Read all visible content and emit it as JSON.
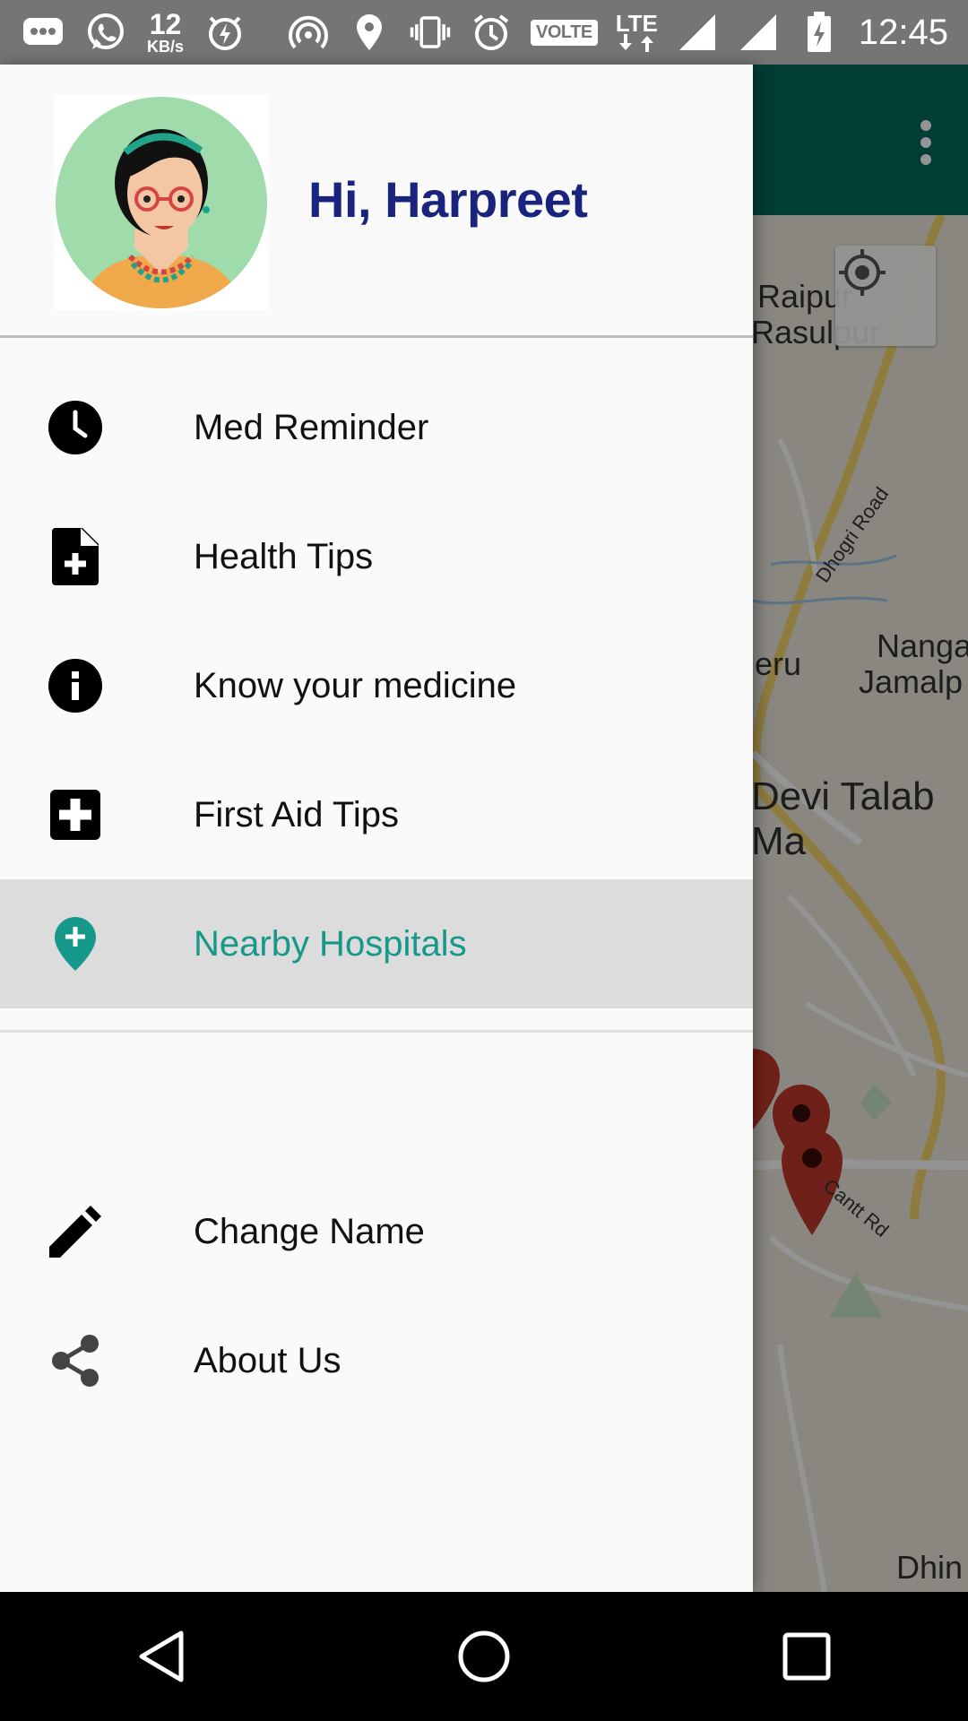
{
  "status_bar": {
    "net_speed_value": "12",
    "net_speed_unit": "KB/s",
    "volte": "VOLTE",
    "lte": "LTE",
    "time": "12:45",
    "icons": [
      "message-icon",
      "whatsapp-icon",
      "net-speed",
      "flash-off-icon",
      "hotspot-icon",
      "location-icon",
      "vibrate-icon",
      "alarm-icon",
      "volte-badge",
      "lte-icon",
      "signal-icon",
      "signal-icon",
      "battery-icon"
    ]
  },
  "drawer": {
    "greeting": "Hi, Harpreet",
    "menu": [
      {
        "label": "Med Reminder",
        "icon": "clock-icon"
      },
      {
        "label": "Health Tips",
        "icon": "note-add-icon"
      },
      {
        "label": "Know your medicine",
        "icon": "info-icon"
      },
      {
        "label": "First Aid Tips",
        "icon": "first-aid-icon"
      },
      {
        "label": "Nearby Hospitals",
        "icon": "hospital-pin-icon",
        "active": true
      }
    ],
    "secondary_menu": [
      {
        "label": "Change Name",
        "icon": "pencil-icon"
      },
      {
        "label": "About Us",
        "icon": "share-icon"
      }
    ],
    "active_color": "#16988a",
    "greeting_color": "#1a237e"
  },
  "map": {
    "labels": {
      "raipur": "Raipur",
      "rasulpur": "Rasulpur",
      "dhogri_road": "Dhogri Road",
      "eru": "eru",
      "nanga": "Nanga",
      "jamalp": "Jamalp",
      "devi_talab": "Devi Talab Ma",
      "cantt_rd": "Cantt Rd",
      "dhin": "Dhin"
    }
  },
  "colors": {
    "toolbar": "#00695c",
    "status_bar": "#757575",
    "marker": "#c0392b"
  }
}
